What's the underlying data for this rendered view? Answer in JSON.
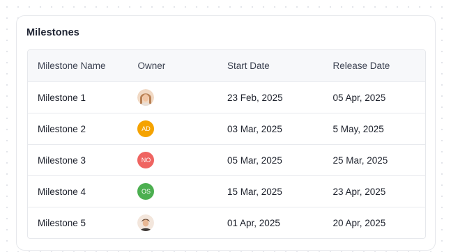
{
  "card": {
    "title": "Milestones"
  },
  "table": {
    "headers": [
      "Milestone Name",
      "Owner",
      "Start Date",
      "Release Date"
    ],
    "rows": [
      {
        "name": "Milestone 1",
        "owner": {
          "type": "photo",
          "icon": "woman-avatar-photo"
        },
        "start": "23 Feb, 2025",
        "release": "05 Apr, 2025"
      },
      {
        "name": "Milestone 2",
        "owner": {
          "type": "initials",
          "initials": "AD",
          "color": "#f5a300"
        },
        "start": "03 Mar, 2025",
        "release": "5 May, 2025"
      },
      {
        "name": "Milestone 3",
        "owner": {
          "type": "initials",
          "initials": "NO",
          "color": "#ef6461"
        },
        "start": "05 Mar, 2025",
        "release": "25 Mar, 2025"
      },
      {
        "name": "Milestone 4",
        "owner": {
          "type": "initials",
          "initials": "OS",
          "color": "#4caf50"
        },
        "start": "15 Mar, 2025",
        "release": "23 Apr, 2025"
      },
      {
        "name": "Milestone 5",
        "owner": {
          "type": "photo",
          "icon": "man-avatar-photo"
        },
        "start": "01 Apr, 2025",
        "release": "20 Apr, 2025"
      }
    ]
  }
}
